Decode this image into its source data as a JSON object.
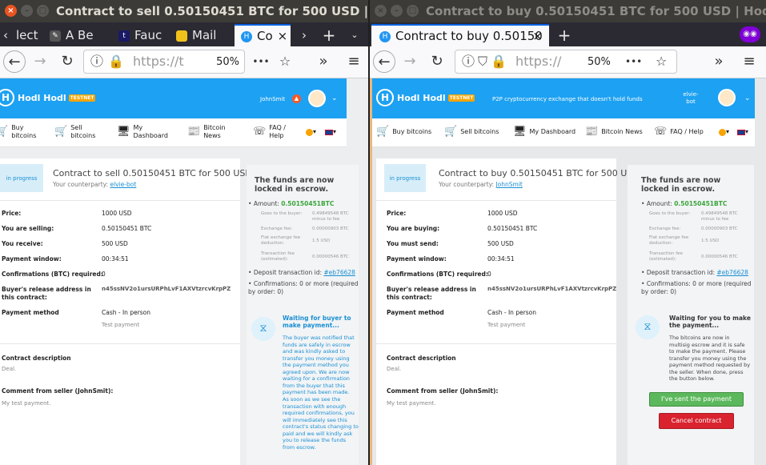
{
  "left": {
    "window_title": "Contract to sell 0.50150451 BTC for 500 USD | Hodl Hodl",
    "tabs": [
      {
        "label": "lect"
      },
      {
        "label": "A Be"
      },
      {
        "label": "Fauc"
      },
      {
        "label": "Mail"
      },
      {
        "label": "Co"
      }
    ],
    "url": "https://t",
    "zoom": "50%",
    "brand": "Hodl Hodl",
    "testnet": "TESTNET",
    "username": "JohnSmit",
    "menu": [
      {
        "label": "Buy bitcoins"
      },
      {
        "label": "Sell bitcoins"
      },
      {
        "label": "My Dashboard"
      },
      {
        "label": "Bitcoin News"
      },
      {
        "label": "FAQ / Help"
      }
    ],
    "status": "in progress",
    "title": "Contract to sell 0.50150451 BTC for 500 USD",
    "counterparty_label": "Your counterparty:",
    "counterparty": "elvie-bot",
    "rows": [
      {
        "label": "Price:",
        "value": "1000 USD"
      },
      {
        "label": "You are selling:",
        "value": "0.50150451 BTC"
      },
      {
        "label": "You receive:",
        "value": "500 USD"
      },
      {
        "label": "Payment window:",
        "value": "00:34:51"
      },
      {
        "label": "Confirmations (BTC) required:",
        "value": "0"
      },
      {
        "label": "Buyer's release address in this contract:",
        "value": "n45ssNV2o1ursURPhLvF1AXVtzrcvKrpPZ"
      },
      {
        "label": "Payment method",
        "value": "Cash - In person",
        "sub": "Test payment"
      }
    ],
    "desc_label": "Contract description",
    "desc": "Deal.",
    "comment_label": "Comment from seller (JohnSmit):",
    "comment": "My test payment.",
    "side_title": "The funds are now locked in escrow.",
    "amount_label": "Amount:",
    "amount": "0.50150451BTC",
    "fees": [
      {
        "k": "Goes to the buyer:",
        "v": "0.49849548 BTC minus to fee"
      },
      {
        "k": "Exchange fee:",
        "v": "0.00000903 BTC"
      },
      {
        "k": "Flat exchange fee deduction:",
        "v": "1.5 USD"
      },
      {
        "k": "Transaction fee (estimated):",
        "v": "0.00000546 BTC"
      }
    ],
    "deposit_label": "Deposit transaction id:",
    "deposit": "#eb76628",
    "conf_label": "Confirmations:",
    "conf": "0 or more (required by order: 0)",
    "wait_title": "Waiting for buyer to make payment...",
    "wait_text1": "The buyer was notified that funds are safely in escrow and was kindly asked to transfer you money using the payment method you agreed upon. We are now waiting for a confirmation from the buyer that this payment has been made.",
    "wait_text2": "As soon as we see the transaction with enough required confirmations, you will immediately see this contract's status changing to paid and we will kindly ask you to release the funds from escrow."
  },
  "right": {
    "window_title": "Contract to buy 0.50150451 BTC for 500 USD | Hodl Hodl",
    "tab": "Contract to buy 0.50150",
    "url": "https://",
    "zoom": "50%",
    "brand": "Hodl Hodl",
    "testnet": "TESTNET",
    "tagline": "P2P cryptocurrency exchange that doesn't hold funds",
    "username": "elvie-bot",
    "menu": [
      {
        "label": "Buy bitcoins"
      },
      {
        "label": "Sell bitcoins"
      },
      {
        "label": "My Dashboard"
      },
      {
        "label": "Bitcoin News"
      },
      {
        "label": "FAQ / Help"
      }
    ],
    "status": "in progress",
    "title": "Contract to buy 0.50150451 BTC for 500 USD",
    "counterparty_label": "Your counterparty:",
    "counterparty": "JohnSmit",
    "rows": [
      {
        "label": "Price:",
        "value": "1000 USD"
      },
      {
        "label": "You are buying:",
        "value": "0.50150451 BTC"
      },
      {
        "label": "You must send:",
        "value": "500 USD"
      },
      {
        "label": "Payment window:",
        "value": "00:34:51"
      },
      {
        "label": "Confirmations (BTC) required:",
        "value": "0"
      },
      {
        "label": "Buyer's release address in this contract:",
        "value": "n45ssNV2o1ursURPhLvF1AXVtzrcvKrpPZ"
      },
      {
        "label": "Payment method",
        "value": "Cash - In person",
        "sub": "Test payment"
      }
    ],
    "desc_label": "Contract description",
    "desc": "Deal.",
    "comment_label": "Comment from seller (JohnSmit):",
    "comment": "My test payment.",
    "side_title": "The funds are now locked in escrow.",
    "amount_label": "Amount:",
    "amount": "0.50150451BTC",
    "fees": [
      {
        "k": "Goes to the buyer:",
        "v": "0.49849548 BTC minus to fee"
      },
      {
        "k": "Exchange fee:",
        "v": "0.00000903 BTC"
      },
      {
        "k": "Flat exchange fee deduction:",
        "v": "1.5 USD"
      },
      {
        "k": "Transaction fee (estimated):",
        "v": "0.00000546 BTC"
      }
    ],
    "deposit_label": "Deposit transaction id:",
    "deposit": "#eb76628",
    "conf_label": "Confirmations:",
    "conf": "0 or more (required by order: 0)",
    "wait_title": "Waiting for you to make the payment...",
    "wait_text": "The bitcoins are now in multisig escrow and it is safe to make the payment. Please transfer you money using the payment method requested by the seller. When done, press the button below.",
    "sent_button": "I've sent the payment",
    "cancel_button": "Cancel contract"
  }
}
